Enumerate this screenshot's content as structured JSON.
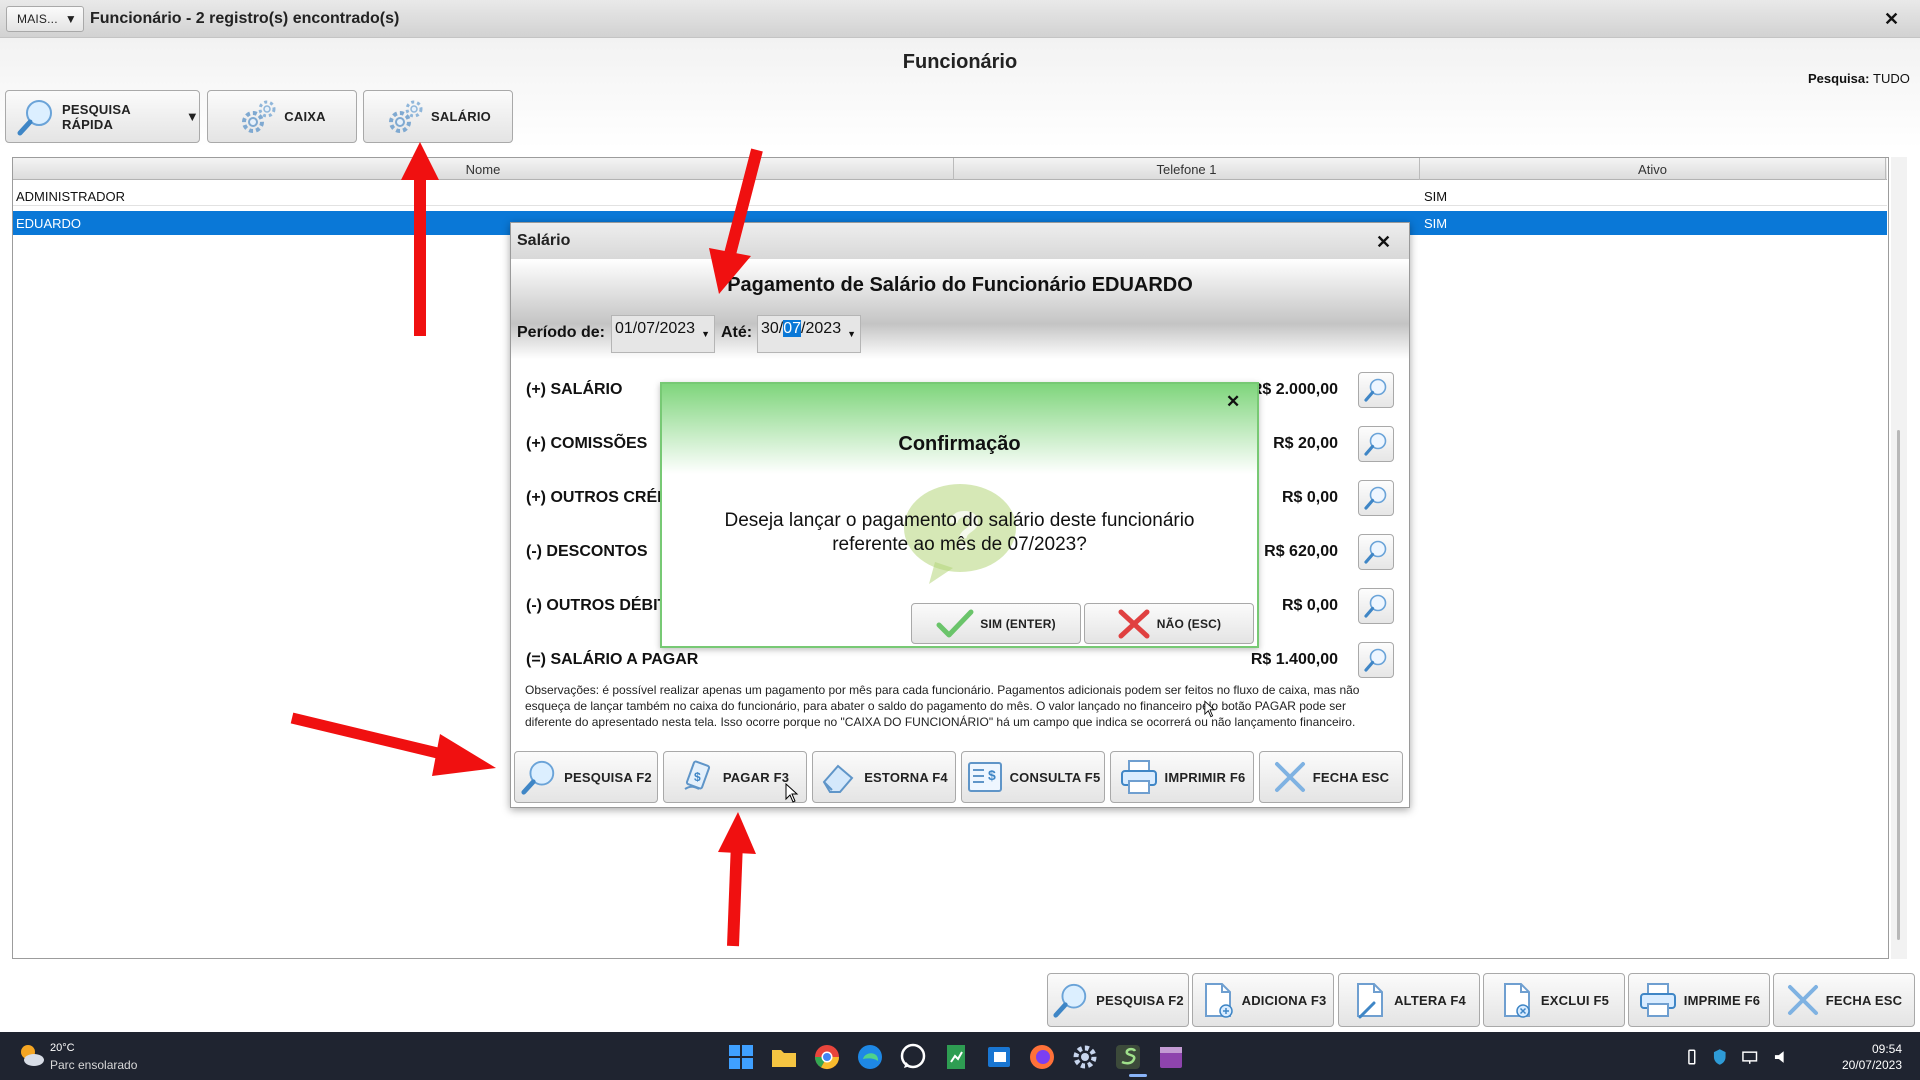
{
  "window": {
    "more_button": "MAIS...",
    "title": "Funcionário - 2 registro(s) encontrado(s)",
    "close": "✕",
    "heading": "Funcionário",
    "search_scope_label": "Pesquisa:",
    "search_scope_value": "TUDO"
  },
  "toolbar": {
    "quick_search": "PESQUISA RÁPIDA",
    "cash": "CAIXA",
    "salary": "SALÁRIO"
  },
  "table": {
    "columns": [
      "Nome",
      "Telefone 1",
      "Ativo"
    ],
    "rows": [
      {
        "nome": "ADMINISTRADOR",
        "telefone": "",
        "ativo": "SIM"
      },
      {
        "nome": "EDUARDO",
        "telefone": "",
        "ativo": "SIM"
      }
    ]
  },
  "bottom_bar": {
    "search": "PESQUISA F2",
    "add": "ADICIONA F3",
    "edit": "ALTERA F4",
    "delete": "EXCLUI F5",
    "print": "IMPRIME F6",
    "close": "FECHA ESC"
  },
  "salary_dialog": {
    "title": "Salário",
    "close": "✕",
    "heading": "Pagamento de Salário do Funcionário EDUARDO",
    "period_label": "Período de:",
    "date_from": "01/07/2023",
    "until_label": "Até:",
    "date_to_prefix": "30/",
    "date_to_selected": "07",
    "date_to_suffix": "/2023",
    "rows": [
      {
        "label": "(+) SALÁRIO",
        "value": "R$ 2.000,00"
      },
      {
        "label": "(+) COMISSÕES",
        "value": "R$ 20,00"
      },
      {
        "label": "(+) OUTROS CRÉDITOS",
        "value": "R$ 0,00"
      },
      {
        "label": "(-) DESCONTOS",
        "value": "R$ 620,00"
      },
      {
        "label": "(-) OUTROS DÉBITOS",
        "value": "R$ 0,00"
      },
      {
        "label": "(=) SALÁRIO A PAGAR",
        "value": "R$ 1.400,00"
      }
    ],
    "observations": "Observações: é possível realizar apenas um pagamento por mês para cada funcionário. Pagamentos adicionais podem ser feitos no fluxo de caixa, mas não esqueça de lançar também no caixa do funcionário, para abater o saldo do pagamento do mês. O valor lançado no financeiro pelo botão PAGAR pode ser diferente do apresentado nesta tela. Isso ocorre porque no \"CAIXA DO FUNCIONÁRIO\" há um campo que indica se ocorrerá ou não lançamento financeiro.",
    "buttons": {
      "search": "PESQUISA F2",
      "pay": "PAGAR F3",
      "reverse": "ESTORNA F4",
      "query": "CONSULTA F5",
      "print": "IMPRIMIR F6",
      "close": "FECHA ESC"
    }
  },
  "confirm_dialog": {
    "title": "Confirmação",
    "close": "✕",
    "message_line1": "Deseja lançar o pagamento do salário deste funcionário",
    "message_line2": "referente ao mês de 07/2023?",
    "yes": "SIM (ENTER)",
    "no": "NÃO (ESC)"
  },
  "taskbar": {
    "temperature": "20°C",
    "weather": "Parc ensolarado",
    "time": "09:54",
    "date": "20/07/2023"
  },
  "colors": {
    "selection": "#0a78d7",
    "arrow": "#f01010",
    "confirm_green": "#7fd57c",
    "taskbar": "#1f2430"
  }
}
